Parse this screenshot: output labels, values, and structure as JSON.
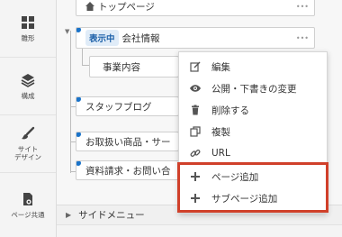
{
  "sidebar": {
    "items": [
      {
        "label": "雛形",
        "icon": "grid-icon"
      },
      {
        "label": "構成",
        "icon": "layers-icon"
      },
      {
        "label": "サイト\nデザイン",
        "icon": "brush-icon"
      },
      {
        "label": "ページ共通",
        "icon": "page-settings-icon"
      }
    ]
  },
  "tree": {
    "top_page": "トップページ",
    "company_badge": "表示中",
    "company": "会社情報",
    "business": "事業内容",
    "staff_blog": "スタッフブログ",
    "products": "お取扱い商品・サー",
    "inquiry": "資料請求・お問い合",
    "more_symbol": "•••"
  },
  "bottom": {
    "side_menu": "サイドメニュー",
    "triangle": "▶"
  },
  "context_menu": {
    "items": [
      {
        "label": "編集",
        "icon": "edit-icon"
      },
      {
        "label": "公開・下書きの変更",
        "icon": "eye-icon"
      },
      {
        "label": "削除する",
        "icon": "trash-icon"
      },
      {
        "label": "複製",
        "icon": "copy-icon"
      },
      {
        "label": "URL",
        "icon": "link-icon"
      },
      {
        "label": "ページ追加",
        "icon": "plus-icon"
      },
      {
        "label": "サブページ追加",
        "icon": "plus-icon"
      }
    ]
  },
  "colors": {
    "accent": "#1a73c9",
    "highlight": "#d0402a"
  }
}
